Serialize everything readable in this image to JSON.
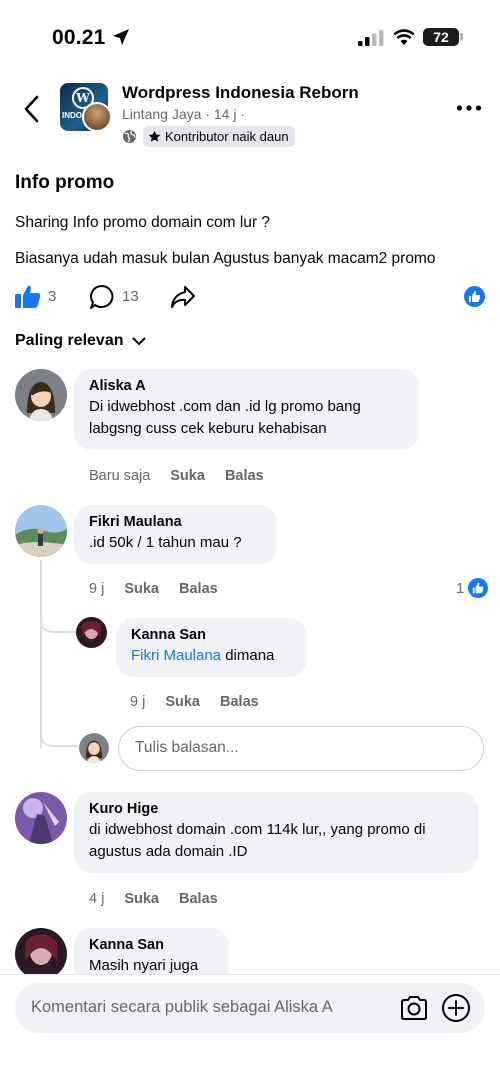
{
  "status": {
    "time": "00.21",
    "battery": "72",
    "location_icon": "location-arrow-icon",
    "signal_icon": "cellular-signal-icon",
    "wifi_icon": "wifi-icon"
  },
  "header": {
    "group_name": "Wordpress Indonesia Reborn",
    "author": "Lintang Jaya",
    "time": "14 j",
    "badge": "Kontributor naik daun",
    "group_avatar_text": "INDONESIA",
    "icons": {
      "back": "chevron-left-icon",
      "more": "more-dots-icon",
      "privacy": "globe-icon",
      "badge": "star-icon"
    }
  },
  "post": {
    "title": "Info promo",
    "line1": "Sharing Info promo domain com lur ?",
    "line2": "Biasanya udah masuk bulan Agustus banyak macam2 promo",
    "likes": "3",
    "comments": "13"
  },
  "sort_label": "Paling relevan",
  "comments": [
    {
      "author": "Aliska A",
      "text": "Di idwebhost .com dan .id lg promo bang labgsng cuss cek keburu kehabisan",
      "time": "Baru saja",
      "like": "Suka",
      "reply": "Balas"
    },
    {
      "author": "Fikri Maulana",
      "text": ".id 50k / 1 tahun mau ?",
      "time": "9 j",
      "like": "Suka",
      "reply": "Balas",
      "reactions": "1",
      "replies": [
        {
          "author": "Kanna San",
          "mention": "Fikri Maulana",
          "text": " dimana",
          "time": "9 j",
          "like": "Suka",
          "reply": "Balas"
        }
      ]
    },
    {
      "author": "Kuro Hige",
      "text": "di idwebhost  domain .com 114k lur,, yang promo di agustus ada domain .ID",
      "time": "4 j",
      "like": "Suka",
      "reply": "Balas"
    },
    {
      "author": "Kanna San",
      "text": "Masih nyari juga"
    }
  ],
  "reply_placeholder": "Tulis balasan...",
  "composer_placeholder": "Komentari secara publik sebagai Aliska A",
  "colors": {
    "accent": "#1877f2",
    "bubble": "#f0f2f5",
    "muted": "#65676b",
    "mention": "#1b74e4"
  }
}
